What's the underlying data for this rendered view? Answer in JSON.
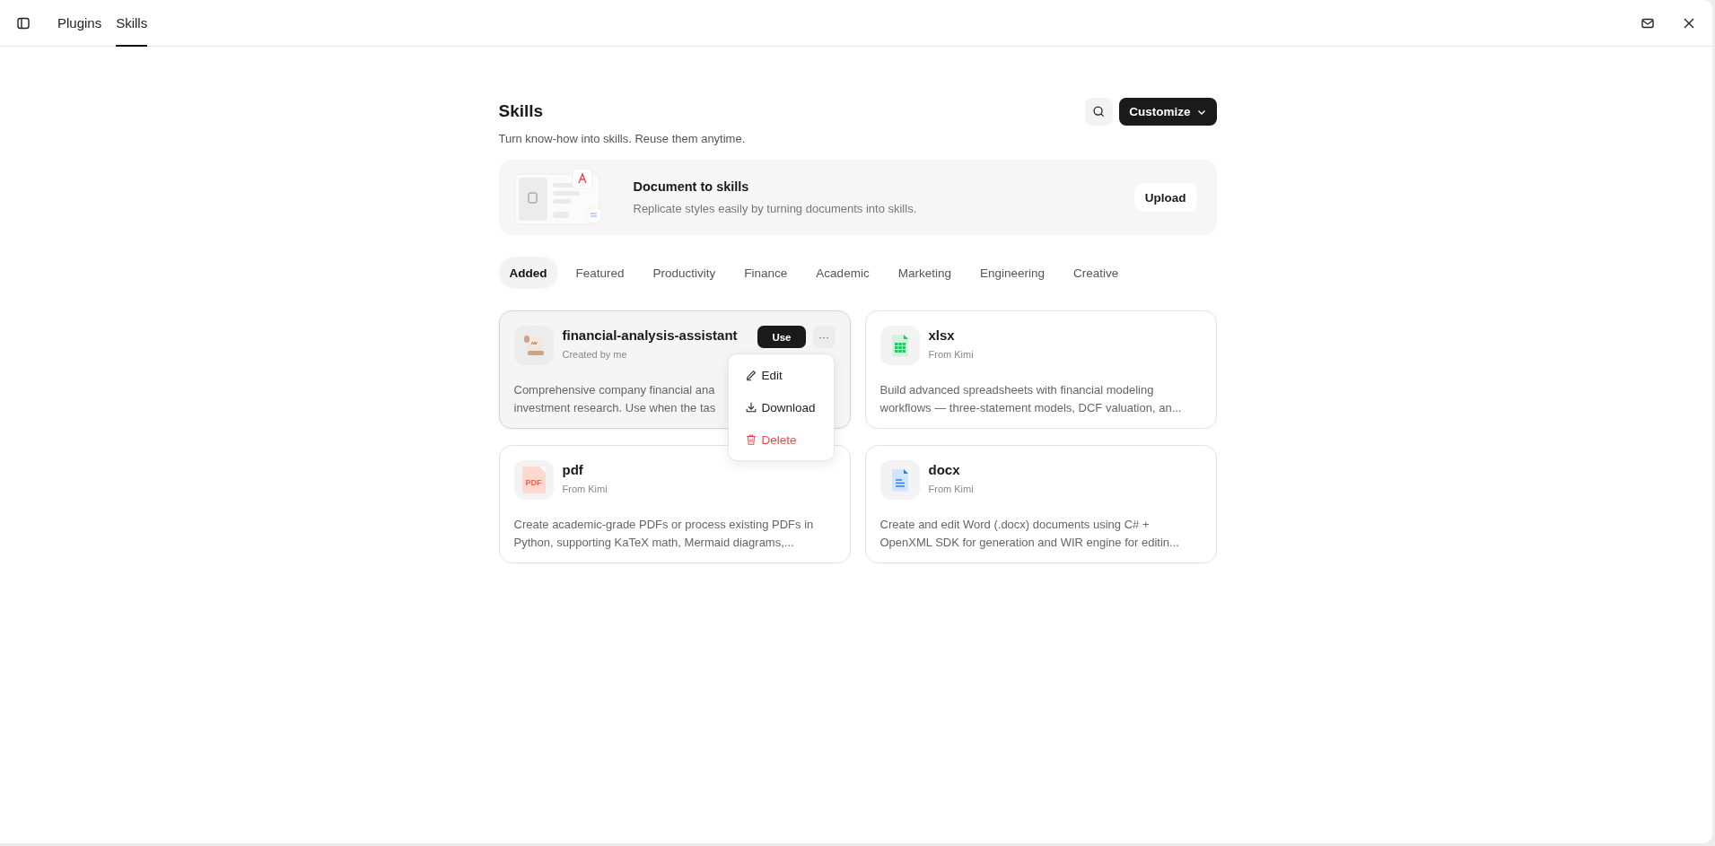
{
  "top_bar": {
    "nav": [
      {
        "label": "Plugins",
        "selected": false
      },
      {
        "label": "Skills",
        "selected": true
      }
    ]
  },
  "header": {
    "title": "Skills",
    "subtitle": "Turn know-how into skills. Reuse them anytime.",
    "customize": "Customize"
  },
  "banner": {
    "title": "Document to skills",
    "description": "Replicate styles easily by turning documents into skills.",
    "button": "Upload"
  },
  "tabs": [
    {
      "label": "Added",
      "selected": true
    },
    {
      "label": "Featured",
      "selected": false
    },
    {
      "label": "Productivity",
      "selected": false
    },
    {
      "label": "Finance",
      "selected": false
    },
    {
      "label": "Academic",
      "selected": false
    },
    {
      "label": "Marketing",
      "selected": false
    },
    {
      "label": "Engineering",
      "selected": false
    },
    {
      "label": "Creative",
      "selected": false
    }
  ],
  "cards": [
    {
      "kind": "custom",
      "name": "financial-analysis-assistant",
      "source": "Created by me",
      "description_lines": [
        "Comprehensive company financial ana",
        "investment research. Use when the tas"
      ],
      "hovered": true,
      "use": "Use",
      "more": "···"
    },
    {
      "kind": "sheet",
      "name": "xlsx",
      "source": "From Kimi",
      "description_lines": [
        "Build advanced spreadsheets with financial modeling",
        "workflows — three-statement models, DCF valuation, an..."
      ],
      "hovered": false
    },
    {
      "kind": "pdf",
      "icon_text": "PDF",
      "name": "pdf",
      "source": "From Kimi",
      "description_lines": [
        "Create academic-grade PDFs or process existing PDFs in",
        "Python, supporting KaTeX math, Mermaid diagrams,..."
      ],
      "hovered": false
    },
    {
      "kind": "doc",
      "name": "docx",
      "source": "From Kimi",
      "description_lines": [
        "Create and edit Word (.docx) documents using C# +",
        "OpenXML SDK for generation and WIR engine for editin..."
      ],
      "hovered": false
    }
  ],
  "menu": {
    "items": [
      {
        "kind": "edit",
        "label": "Edit"
      },
      {
        "kind": "download",
        "label": "Download"
      },
      {
        "kind": "delete",
        "label": "Delete"
      }
    ]
  }
}
